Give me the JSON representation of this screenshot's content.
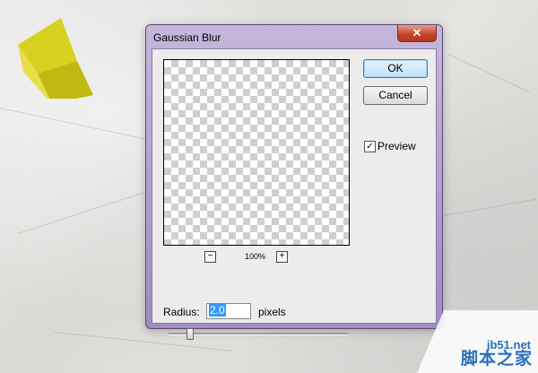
{
  "dialog": {
    "title": "Gaussian Blur",
    "close_glyph": "✕",
    "buttons": {
      "ok": "OK",
      "cancel": "Cancel"
    },
    "preview": {
      "label": "Preview",
      "checked": true,
      "check_glyph": "✓"
    },
    "zoom": {
      "minus": "−",
      "plus": "+",
      "level": "100%"
    },
    "radius": {
      "label": "Radius:",
      "value": "2.0",
      "units": "pixels"
    }
  },
  "watermark": {
    "site": "jb51.net",
    "name": "脚本之家"
  }
}
